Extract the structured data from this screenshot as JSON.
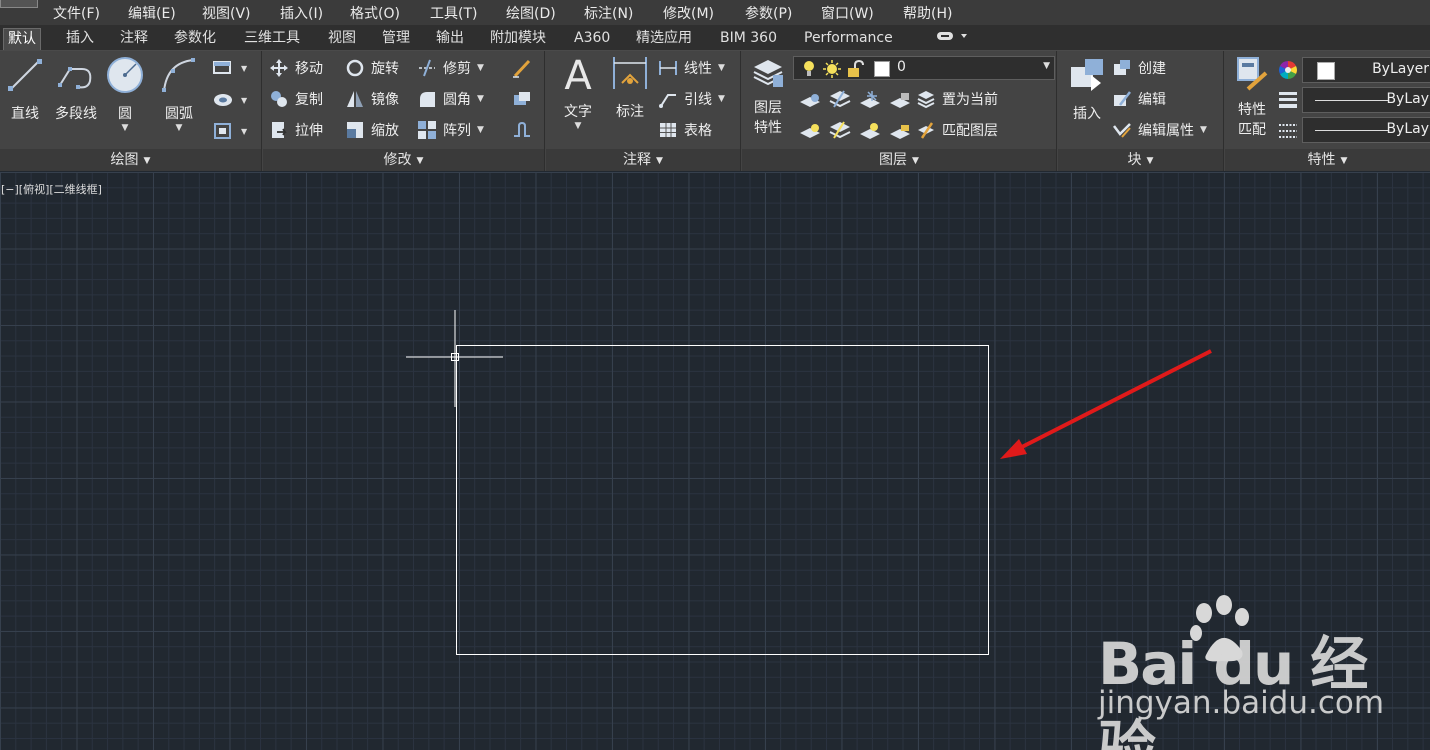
{
  "menu": [
    "文件(F)",
    "编辑(E)",
    "视图(V)",
    "插入(I)",
    "格式(O)",
    "工具(T)",
    "绘图(D)",
    "标注(N)",
    "修改(M)",
    "参数(P)",
    "窗口(W)",
    "帮助(H)"
  ],
  "tabs": [
    "默认",
    "插入",
    "注释",
    "参数化",
    "三维工具",
    "视图",
    "管理",
    "输出",
    "附加模块",
    "A360",
    "精选应用",
    "BIM 360",
    "Performance"
  ],
  "active_tab": "默认",
  "draw_panel": {
    "title": "绘图",
    "line": "直线",
    "polyline": "多段线",
    "circle": "圆",
    "arc": "圆弧"
  },
  "modify_panel": {
    "title": "修改",
    "move": "移动",
    "rotate": "旋转",
    "trim": "修剪",
    "copy": "复制",
    "mirror": "镜像",
    "fillet": "圆角",
    "stretch": "拉伸",
    "scale": "缩放",
    "array": "阵列"
  },
  "annotation_panel": {
    "title": "注释",
    "text": "文字",
    "dimension": "标注",
    "linear": "线性",
    "leader": "引线",
    "table": "表格"
  },
  "layers_panel": {
    "title": "图层",
    "layer_props_1": "图层",
    "layer_props_2": "特性",
    "current_layer": "0",
    "set_current": "置为当前",
    "match_layer": "匹配图层"
  },
  "block_panel": {
    "title": "块",
    "insert": "插入",
    "create": "创建",
    "edit": "编辑",
    "edit_attributes": "编辑属性"
  },
  "properties_panel": {
    "title": "特性",
    "match_1": "特性",
    "match_2": "匹配",
    "color": "ByLayer",
    "linetype": "ByLay",
    "lineweight": "ByLay"
  },
  "viewport_label": "[−][俯视][二维线框]",
  "watermark": {
    "brand": "Bai du 经验",
    "url": "jingyan.baidu.com"
  },
  "colors": {
    "canvas": "#212830",
    "rectangle": "#ffffff",
    "arrow": "#e01a1a",
    "ribbon": "#444444"
  }
}
